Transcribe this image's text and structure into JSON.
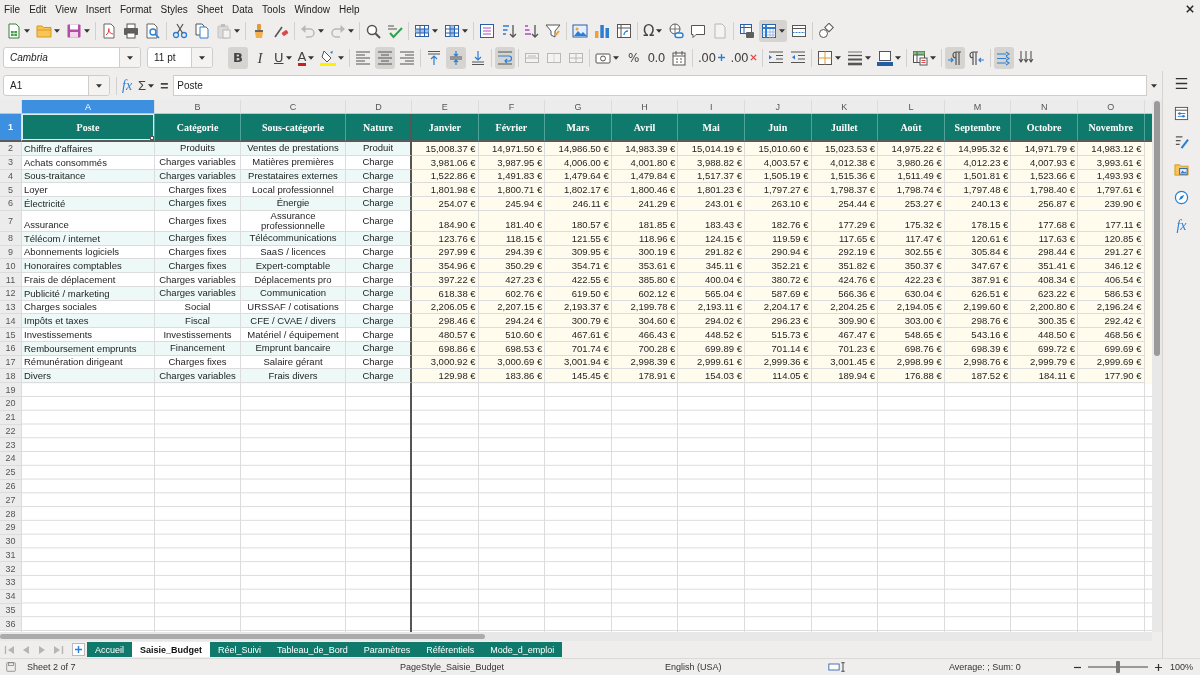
{
  "menu": [
    "File",
    "Edit",
    "View",
    "Insert",
    "Format",
    "Styles",
    "Sheet",
    "Data",
    "Tools",
    "Window",
    "Help"
  ],
  "standard_toolbar": {
    "paste_disabled": true,
    "undo_disabled": true,
    "redo_disabled": true,
    "special_character_glyph": "Ω",
    "headers_footers_disabled": true,
    "freeze_on": true
  },
  "format_toolbar": {
    "font_name": "Cambria",
    "font_size": "11 pt",
    "bold": {
      "glyph": "B",
      "on": true
    },
    "italic": {
      "glyph": "I",
      "on": false
    },
    "underline": {
      "glyph": "U",
      "on": false
    },
    "font_color_glyph": "A",
    "align_left": false,
    "align_center": true,
    "align_right": false,
    "align_top": false,
    "align_middle": true,
    "align_bottom": false,
    "wrap_text": true,
    "merge_disabled": true,
    "percent_glyph": "%",
    "number_glyph": "0.0",
    "add_decimal_glyph": ".00",
    "delete_decimal_glyph": ".00",
    "paragraph_ltr": true,
    "paragraph_rtl": false,
    "text_horizontal": true,
    "text_vertical": false
  },
  "formula_bar": {
    "name_box": "A1",
    "function_glyph": "fx",
    "sum_glyph": "Σ",
    "equals_glyph": "=",
    "formula": "Poste"
  },
  "sheet": {
    "column_letters": [
      {
        "label": "A",
        "selected": true
      },
      {
        "label": "B",
        "selected": false
      },
      {
        "label": "C",
        "selected": false
      },
      {
        "label": "D",
        "selected": false
      },
      {
        "label": "E",
        "selected": false
      },
      {
        "label": "F",
        "selected": false
      },
      {
        "label": "G",
        "selected": false
      },
      {
        "label": "H",
        "selected": false
      },
      {
        "label": "I",
        "selected": false
      },
      {
        "label": "J",
        "selected": false
      },
      {
        "label": "K",
        "selected": false
      },
      {
        "label": "L",
        "selected": false
      },
      {
        "label": "M",
        "selected": false
      },
      {
        "label": "N",
        "selected": false
      },
      {
        "label": "O",
        "selected": false
      }
    ],
    "row_numbers": [
      {
        "label": "1",
        "selected": true
      },
      {
        "label": "2",
        "selected": false
      },
      {
        "label": "3",
        "selected": false
      },
      {
        "label": "4",
        "selected": false
      },
      {
        "label": "5",
        "selected": false
      },
      {
        "label": "6",
        "selected": false
      },
      {
        "label": "7",
        "selected": false
      },
      {
        "label": "8",
        "selected": false
      },
      {
        "label": "9",
        "selected": false
      },
      {
        "label": "10",
        "selected": false
      },
      {
        "label": "11",
        "selected": false
      },
      {
        "label": "12",
        "selected": false
      },
      {
        "label": "13",
        "selected": false
      },
      {
        "label": "14",
        "selected": false
      },
      {
        "label": "15",
        "selected": false
      },
      {
        "label": "16",
        "selected": false
      },
      {
        "label": "17",
        "selected": false
      },
      {
        "label": "18",
        "selected": false
      },
      {
        "label": "19",
        "selected": false
      },
      {
        "label": "20",
        "selected": false
      },
      {
        "label": "21",
        "selected": false
      },
      {
        "label": "22",
        "selected": false
      },
      {
        "label": "23",
        "selected": false
      },
      {
        "label": "24",
        "selected": false
      },
      {
        "label": "25",
        "selected": false
      },
      {
        "label": "26",
        "selected": false
      },
      {
        "label": "27",
        "selected": false
      },
      {
        "label": "28",
        "selected": false
      },
      {
        "label": "29",
        "selected": false
      },
      {
        "label": "30",
        "selected": false
      },
      {
        "label": "31",
        "selected": false
      },
      {
        "label": "32",
        "selected": false
      },
      {
        "label": "33",
        "selected": false
      },
      {
        "label": "34",
        "selected": false
      },
      {
        "label": "35",
        "selected": false
      },
      {
        "label": "36",
        "selected": false
      }
    ],
    "header": [
      "Poste",
      "Catégorie",
      "Sous-catégorie",
      "Nature",
      "Janvier",
      "Février",
      "Mars",
      "Avril",
      "Mai",
      "Juin",
      "Juillet",
      "Août",
      "Septembre",
      "Octobre",
      "Novembre"
    ],
    "rows": [
      [
        "Chiffre d'affaires",
        "Produits",
        "Ventes de prestations",
        "Produit",
        "15,008.37 €",
        "14,971.50 €",
        "14,986.50 €",
        "14,983.39 €",
        "15,014.19 €",
        "15,010.60 €",
        "15,023.53 €",
        "14,975.22 €",
        "14,995.32 €",
        "14,971.79 €",
        "14,983.12 €"
      ],
      [
        "Achats consommés",
        "Charges variables",
        "Matières premières",
        "Charge",
        "3,981.06 €",
        "3,987.95 €",
        "4,006.00 €",
        "4,001.80 €",
        "3,988.82 €",
        "4,003.57 €",
        "4,012.38 €",
        "3,980.26 €",
        "4,012.23 €",
        "4,007.93 €",
        "3,993.61 €"
      ],
      [
        "Sous-traitance",
        "Charges variables",
        "Prestataires externes",
        "Charge",
        "1,522.86 €",
        "1,491.83 €",
        "1,479.64 €",
        "1,479.84 €",
        "1,517.37 €",
        "1,505.19 €",
        "1,515.36 €",
        "1,511.49 €",
        "1,501.81 €",
        "1,523.66 €",
        "1,493.93 €"
      ],
      [
        "Loyer",
        "Charges fixes",
        "Local professionnel",
        "Charge",
        "1,801.98 €",
        "1,800.71 €",
        "1,802.17 €",
        "1,800.46 €",
        "1,801.23 €",
        "1,797.27 €",
        "1,798.37 €",
        "1,798.74 €",
        "1,797.48 €",
        "1,798.40 €",
        "1,797.61 €"
      ],
      [
        "Électricité",
        "Charges fixes",
        "Énergie",
        "Charge",
        "254.07 €",
        "245.94 €",
        "246.11 €",
        "241.29 €",
        "243.01 €",
        "263.10 €",
        "254.44 €",
        "253.27 €",
        "240.13 €",
        "256.87 €",
        "239.90 €"
      ],
      [
        "Assurance",
        "Charges fixes",
        "Assurance professionnelle",
        "Charge",
        "184.90 €",
        "181.40 €",
        "180.57 €",
        "181.85 €",
        "183.43 €",
        "182.76 €",
        "177.29 €",
        "175.32 €",
        "178.15 €",
        "177.68 €",
        "177.11 €"
      ],
      [
        "Télécom / internet",
        "Charges fixes",
        "Télécommunications",
        "Charge",
        "123.76 €",
        "118.15 €",
        "121.55 €",
        "118.96 €",
        "124.15 €",
        "119.59 €",
        "117.65 €",
        "117.47 €",
        "120.61 €",
        "117.63 €",
        "120.85 €"
      ],
      [
        "Abonnements logiciels",
        "Charges fixes",
        "SaaS / licences",
        "Charge",
        "297.99 €",
        "294.39 €",
        "309.95 €",
        "300.19 €",
        "291.82 €",
        "290.94 €",
        "292.19 €",
        "302.55 €",
        "305.84 €",
        "298.44 €",
        "291.27 €"
      ],
      [
        "Honoraires comptables",
        "Charges fixes",
        "Expert-comptable",
        "Charge",
        "354.96 €",
        "350.29 €",
        "354.71 €",
        "353.61 €",
        "345.11 €",
        "352.21 €",
        "351.82 €",
        "350.37 €",
        "347.67 €",
        "351.41 €",
        "346.12 €"
      ],
      [
        "Frais de déplacement",
        "Charges variables",
        "Déplacements pro",
        "Charge",
        "397.22 €",
        "427.23 €",
        "422.55 €",
        "385.80 €",
        "400.04 €",
        "380.72 €",
        "424.76 €",
        "422.23 €",
        "387.91 €",
        "408.34 €",
        "406.54 €"
      ],
      [
        "Publicité / marketing",
        "Charges variables",
        "Communication",
        "Charge",
        "618.38 €",
        "602.76 €",
        "619.50 €",
        "602.12 €",
        "565.04 €",
        "587.69 €",
        "566.36 €",
        "630.04 €",
        "626.51 €",
        "623.22 €",
        "586.53 €"
      ],
      [
        "Charges sociales",
        "Social",
        "URSSAF / cotisations",
        "Charge",
        "2,206.05 €",
        "2,207.15 €",
        "2,193.37 €",
        "2,199.78 €",
        "2,193.11 €",
        "2,204.17 €",
        "2,204.25 €",
        "2,194.05 €",
        "2,199.60 €",
        "2,200.80 €",
        "2,196.24 €"
      ],
      [
        "Impôts et taxes",
        "Fiscal",
        "CFE / CVAE / divers",
        "Charge",
        "298.46 €",
        "294.24 €",
        "300.79 €",
        "304.60 €",
        "294.02 €",
        "296.23 €",
        "309.90 €",
        "303.00 €",
        "298.76 €",
        "300.35 €",
        "292.42 €"
      ],
      [
        "Investissements",
        "Investissements",
        "Matériel / équipement",
        "Charge",
        "480.57 €",
        "510.60 €",
        "467.61 €",
        "466.43 €",
        "448.52 €",
        "515.73 €",
        "467.47 €",
        "548.65 €",
        "543.16 €",
        "448.50 €",
        "468.56 €"
      ],
      [
        "Remboursement emprunts",
        "Financement",
        "Emprunt bancaire",
        "Charge",
        "698.86 €",
        "698.53 €",
        "701.74 €",
        "700.28 €",
        "699.89 €",
        "701.14 €",
        "701.23 €",
        "698.76 €",
        "698.39 €",
        "699.72 €",
        "699.69 €"
      ],
      [
        "Rémunération dirigeant",
        "Charges fixes",
        "Salaire gérant",
        "Charge",
        "3,000.92 €",
        "3,000.69 €",
        "3,001.94 €",
        "2,998.39 €",
        "2,999.61 €",
        "2,999.36 €",
        "3,001.45 €",
        "2,998.99 €",
        "2,998.76 €",
        "2,999.79 €",
        "2,999.69 €"
      ],
      [
        "Divers",
        "Charges variables",
        "Frais divers",
        "Charge",
        "129.98 €",
        "183.86 €",
        "145.45 €",
        "178.91 €",
        "154.03 €",
        "114.05 €",
        "189.94 €",
        "176.88 €",
        "187.52 €",
        "184.11 €",
        "177.90 €"
      ]
    ]
  },
  "sheet_tabs": [
    {
      "label": "Accueil",
      "selected": false
    },
    {
      "label": "Saisie_Budget",
      "selected": true
    },
    {
      "label": "Réel_Suivi",
      "selected": false
    },
    {
      "label": "Tableau_de_Bord",
      "selected": false
    },
    {
      "label": "Paramètres",
      "selected": false
    },
    {
      "label": "Référentiels",
      "selected": false
    },
    {
      "label": "Mode_d_emploi",
      "selected": false
    }
  ],
  "sidebar": {
    "functions_glyph": "fx"
  },
  "status_bar": {
    "sheet": "Sheet 2 of 7",
    "page_style": "PageStyle_Saisie_Budget",
    "language": "English (USA)",
    "selection_summary": "Average: ; Sum: 0",
    "zoom_slider": {
      "level": 0.5
    },
    "zoom": "100%"
  }
}
